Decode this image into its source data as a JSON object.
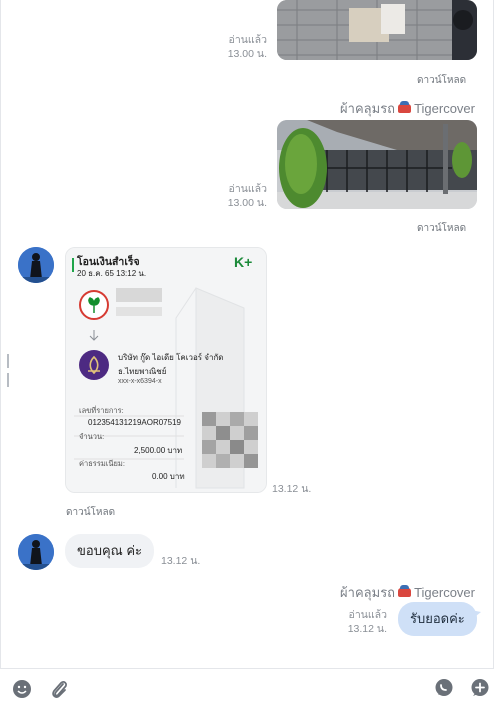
{
  "messages": {
    "m1": {
      "status": "อ่านแล้ว",
      "time": "13.00 น.",
      "download": "ดาวน์โหลด"
    },
    "sender1": {
      "name": "ผ้าคลุมรถ",
      "brand": "Tigercover"
    },
    "m2": {
      "status": "อ่านแล้ว",
      "time": "13.00 น.",
      "download": "ดาวน์โหลด"
    },
    "m3": {
      "time": "13.12 น.",
      "download": "ดาวน์โหลด"
    },
    "m4": {
      "text": "ขอบคุณ ค่ะ",
      "time": "13.12 น."
    },
    "sender2": {
      "name": "ผ้าคลุมรถ",
      "brand": "Tigercover"
    },
    "m5": {
      "status": "อ่านแล้ว",
      "time": "13.12 น.",
      "text": "รับยอดค่ะ"
    }
  },
  "slip": {
    "title": "โอนเงินสำเร็จ",
    "datetime": "20 ธ.ค. 65  13:12 น.",
    "logo": "K+",
    "recipient_name": "บริษัท กู๊ด ไอเดีย โคเวอร์ จำกัด",
    "recipient_bank": "ธ.ไทยพาณิชย์",
    "recipient_account": "xxx-x-x6394-x",
    "ref_label": "เลขที่รายการ:",
    "ref_value": "012354131219AOR07519",
    "amount_label": "จำนวน:",
    "amount_value": "2,500.00 บาท",
    "fee_label": "ค่าธรรมเนียม:",
    "fee_value": "0.00 บาท"
  },
  "colors": {
    "accent": "#3a72c8",
    "outgoing_bubble": "#cfe0f7",
    "incoming_bubble": "#f0f2f5",
    "kbank_green": "#138f2d"
  },
  "icons": [
    "emoji-icon",
    "paperclip-icon",
    "chat-bubble-icon",
    "add-message-icon"
  ]
}
